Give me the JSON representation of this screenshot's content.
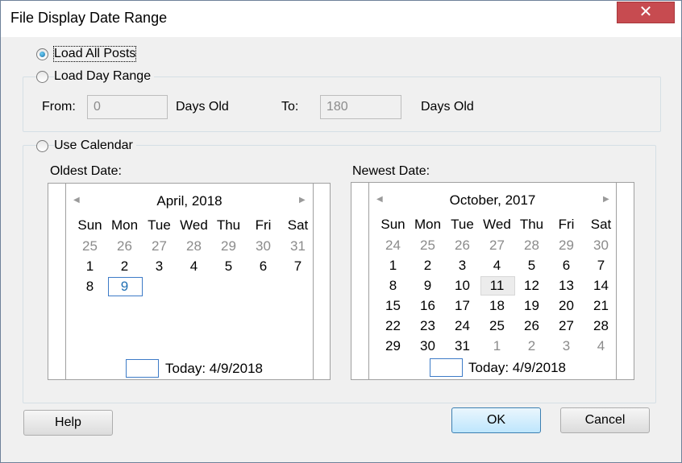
{
  "window": {
    "title": "File Display Date Range",
    "close_glyph": "✕"
  },
  "options": {
    "load_all": "Load All Posts",
    "load_range": "Load Day Range",
    "use_calendar": "Use Calendar",
    "selected": "load_all"
  },
  "range": {
    "from_label": "From:",
    "from_value": "0",
    "from_unit": "Days Old",
    "to_label": "To:",
    "to_value": "180",
    "to_unit": "Days Old"
  },
  "oldest": {
    "label": "Oldest Date:",
    "month": "April, 2018",
    "weekdays": [
      "Sun",
      "Mon",
      "Tue",
      "Wed",
      "Thu",
      "Fri",
      "Sat"
    ],
    "weeks": [
      [
        {
          "d": "25",
          "o": true
        },
        {
          "d": "26",
          "o": true
        },
        {
          "d": "27",
          "o": true
        },
        {
          "d": "28",
          "o": true
        },
        {
          "d": "29",
          "o": true
        },
        {
          "d": "30",
          "o": true
        },
        {
          "d": "31",
          "o": true
        }
      ],
      [
        {
          "d": "1"
        },
        {
          "d": "2"
        },
        {
          "d": "3"
        },
        {
          "d": "4"
        },
        {
          "d": "5"
        },
        {
          "d": "6"
        },
        {
          "d": "7"
        }
      ],
      [
        {
          "d": "8"
        },
        {
          "d": "9",
          "sel": true
        }
      ]
    ],
    "today": "Today: 4/9/2018"
  },
  "newest": {
    "label": "Newest Date:",
    "month": "October, 2017",
    "weekdays": [
      "Sun",
      "Mon",
      "Tue",
      "Wed",
      "Thu",
      "Fri",
      "Sat"
    ],
    "weeks": [
      [
        {
          "d": "24",
          "o": true
        },
        {
          "d": "25",
          "o": true
        },
        {
          "d": "26",
          "o": true
        },
        {
          "d": "27",
          "o": true
        },
        {
          "d": "28",
          "o": true
        },
        {
          "d": "29",
          "o": true
        },
        {
          "d": "30",
          "o": true
        }
      ],
      [
        {
          "d": "1"
        },
        {
          "d": "2"
        },
        {
          "d": "3"
        },
        {
          "d": "4"
        },
        {
          "d": "5"
        },
        {
          "d": "6"
        },
        {
          "d": "7"
        }
      ],
      [
        {
          "d": "8"
        },
        {
          "d": "9"
        },
        {
          "d": "10"
        },
        {
          "d": "11",
          "hl": true
        },
        {
          "d": "12"
        },
        {
          "d": "13"
        },
        {
          "d": "14"
        }
      ],
      [
        {
          "d": "15"
        },
        {
          "d": "16"
        },
        {
          "d": "17"
        },
        {
          "d": "18"
        },
        {
          "d": "19"
        },
        {
          "d": "20"
        },
        {
          "d": "21"
        }
      ],
      [
        {
          "d": "22"
        },
        {
          "d": "23"
        },
        {
          "d": "24"
        },
        {
          "d": "25"
        },
        {
          "d": "26"
        },
        {
          "d": "27"
        },
        {
          "d": "28"
        }
      ],
      [
        {
          "d": "29"
        },
        {
          "d": "30"
        },
        {
          "d": "31"
        },
        {
          "d": "1",
          "o": true
        },
        {
          "d": "2",
          "o": true
        },
        {
          "d": "3",
          "o": true
        },
        {
          "d": "4",
          "o": true
        }
      ]
    ],
    "today": "Today: 4/9/2018"
  },
  "buttons": {
    "help": "Help",
    "ok": "OK",
    "cancel": "Cancel"
  }
}
